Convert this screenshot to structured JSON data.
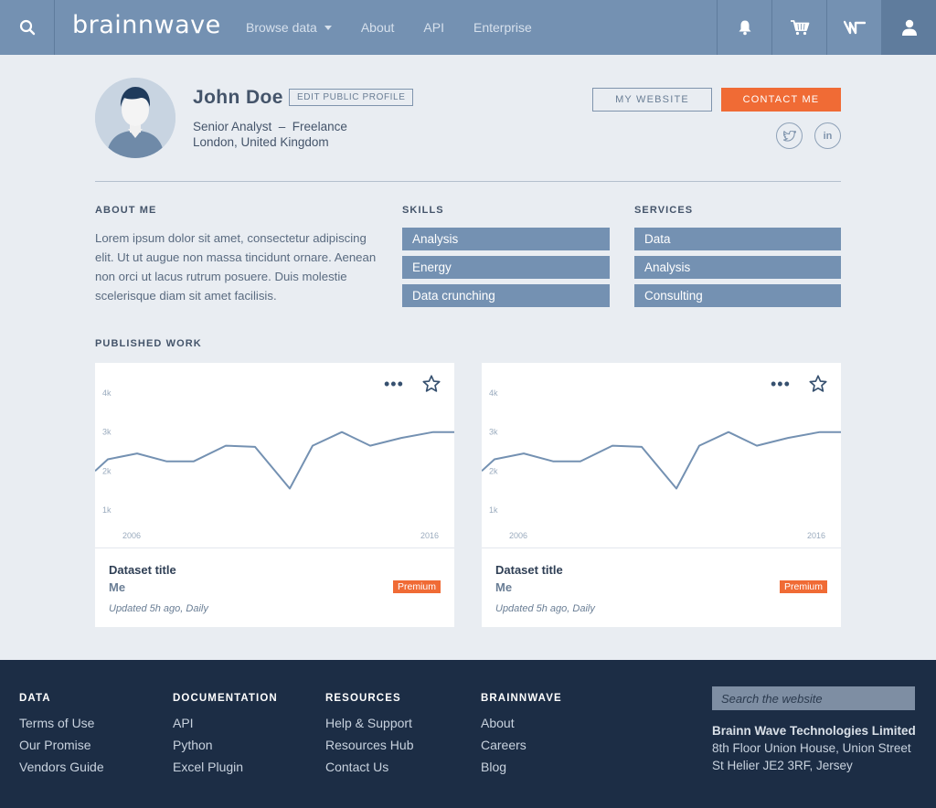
{
  "nav": {
    "logo": "brainnwave",
    "items": [
      {
        "label": "Browse data",
        "has_caret": true
      },
      {
        "label": "About"
      },
      {
        "label": "API"
      },
      {
        "label": "Enterprise"
      }
    ],
    "icons": [
      "search-icon",
      "bell-icon",
      "cart-icon",
      "wave-icon",
      "user-icon"
    ]
  },
  "profile": {
    "name": "John Doe",
    "edit_label": "EDIT PUBLIC PROFILE",
    "role": "Senior Analyst  –  Freelance",
    "location": "London, United Kingdom",
    "website_label": "MY WEBSITE",
    "contact_label": "CONTACT ME",
    "social": [
      "twitter-icon",
      "linkedin-icon"
    ],
    "linkedin_text": "in"
  },
  "about": {
    "heading": "ABOUT ME",
    "text": "Lorem ipsum dolor sit amet, consectetur adipiscing elit. Ut ut augue non massa tincidunt ornare. Aenean non orci ut lacus rutrum posuere. Duis molestie scelerisque diam sit amet facilisis."
  },
  "skills": {
    "heading": "SKILLS",
    "items": [
      "Analysis",
      "Energy",
      "Data crunching"
    ]
  },
  "services": {
    "heading": "SERVICES",
    "items": [
      "Data",
      "Analysis",
      "Consulting"
    ]
  },
  "published": {
    "heading": "PUBLISHED WORK",
    "cards": [
      {
        "title": "Dataset title",
        "owner": "Me",
        "badge": "Premium",
        "updated": "Updated 5h ago, Daily"
      },
      {
        "title": "Dataset title",
        "owner": "Me",
        "badge": "Premium",
        "updated": "Updated 5h ago, Daily"
      }
    ]
  },
  "chart_data": [
    {
      "type": "line",
      "y_tick_labels": [
        "4k",
        "3k",
        "2k",
        "1k"
      ],
      "y_ticks": [
        4000,
        3000,
        2000,
        1000
      ],
      "x_tick_labels": [
        "2006",
        "2016"
      ],
      "ylim": [
        500,
        4400
      ],
      "grid": false,
      "y": [
        2000,
        2300,
        2450,
        2250,
        2250,
        2650,
        2620,
        1550,
        2650,
        3000,
        2650,
        2850,
        3000,
        3000
      ],
      "color": "#7491b2"
    },
    {
      "type": "line",
      "y_tick_labels": [
        "4k",
        "3k",
        "2k",
        "1k"
      ],
      "y_ticks": [
        4000,
        3000,
        2000,
        1000
      ],
      "x_tick_labels": [
        "2006",
        "2016"
      ],
      "ylim": [
        500,
        4400
      ],
      "grid": false,
      "y": [
        2000,
        2300,
        2450,
        2250,
        2250,
        2650,
        2620,
        1550,
        2650,
        3000,
        2650,
        2850,
        3000,
        3000
      ],
      "color": "#7491b2"
    }
  ],
  "footer": {
    "columns": [
      {
        "heading": "DATA",
        "links": [
          "Terms of Use",
          "Our Promise",
          "Vendors Guide"
        ]
      },
      {
        "heading": "DOCUMENTATION",
        "links": [
          "API",
          "Python",
          "Excel Plugin"
        ]
      },
      {
        "heading": "RESOURCES",
        "links": [
          "Help & Support",
          "Resources Hub",
          "Contact Us"
        ]
      },
      {
        "heading": "BRAINNWAVE",
        "links": [
          "About",
          "Careers",
          "Blog"
        ]
      }
    ],
    "search_placeholder": "Search the website",
    "company_name": "Brainn Wave Technologies Limited",
    "address_line1": "8th Floor Union House, Union Street",
    "address_line2": "St Helier JE2 3RF, Jersey"
  },
  "colors": {
    "nav": "#7491b2",
    "accent": "#f06b35",
    "footer": "#1c2d45",
    "tag": "#7491b2"
  }
}
